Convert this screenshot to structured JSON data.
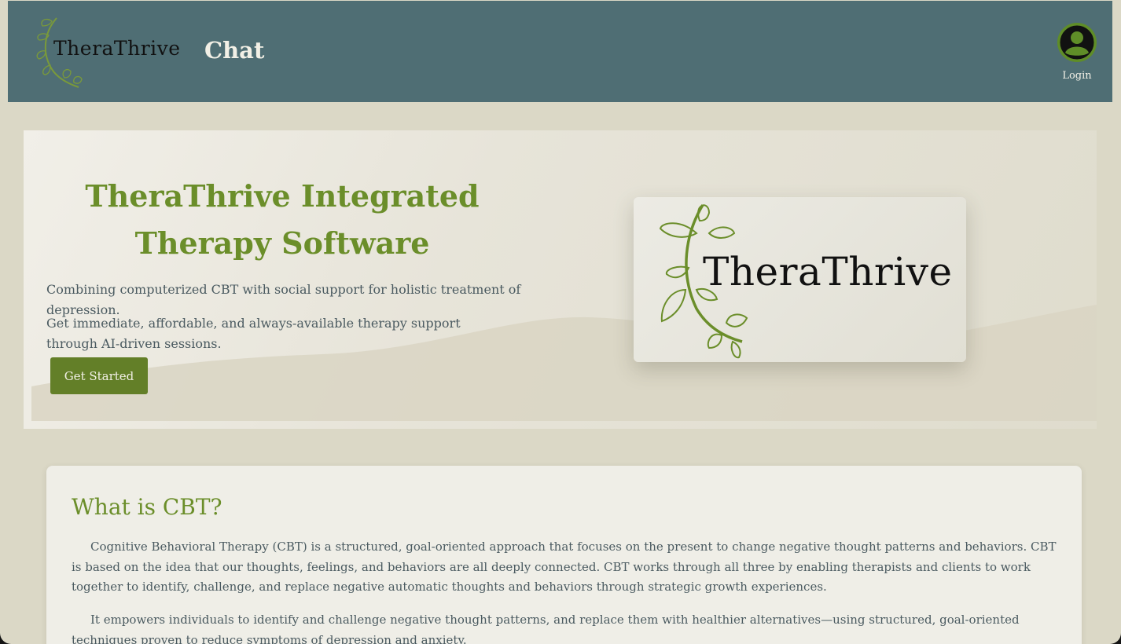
{
  "nav": {
    "logo_text": "TheraThrive",
    "chat_label": "Chat",
    "login_label": "Login"
  },
  "hero": {
    "title": "TheraThrive Integrated Therapy Software",
    "subtitle": "Combining computerized CBT with social support for holistic treatment of depression.",
    "description": "Get immediate, affordable, and always-available therapy support through AI-driven sessions.",
    "cta_label": "Get Started",
    "logo_text": "TheraThrive"
  },
  "cbt": {
    "title": "What is CBT?",
    "paragraph_1": "Cognitive Behavioral Therapy (CBT) is a structured, goal-oriented approach that focuses on the present to change negative thought patterns and behaviors. CBT is based on the idea that our thoughts, feelings, and behaviors are all deeply connected. CBT works through all three by enabling therapists and clients to work together to identify, challenge, and replace negative automatic thoughts and behaviors through strategic growth experiences.",
    "paragraph_2": "It empowers individuals to identify and challenge negative thought patterns, and replace them with healthier alternatives—using structured, goal-oriented techniques proven to reduce symptoms of depression and anxiety."
  },
  "colors": {
    "navbar": "#4f6e74",
    "page_bg": "#dbd8c6",
    "accent_green": "#6b8e2a",
    "button_green": "#637f28",
    "text": "#4a5a60"
  },
  "icons": {
    "logo": "vine-leaf-icon",
    "user": "user-avatar-icon"
  }
}
